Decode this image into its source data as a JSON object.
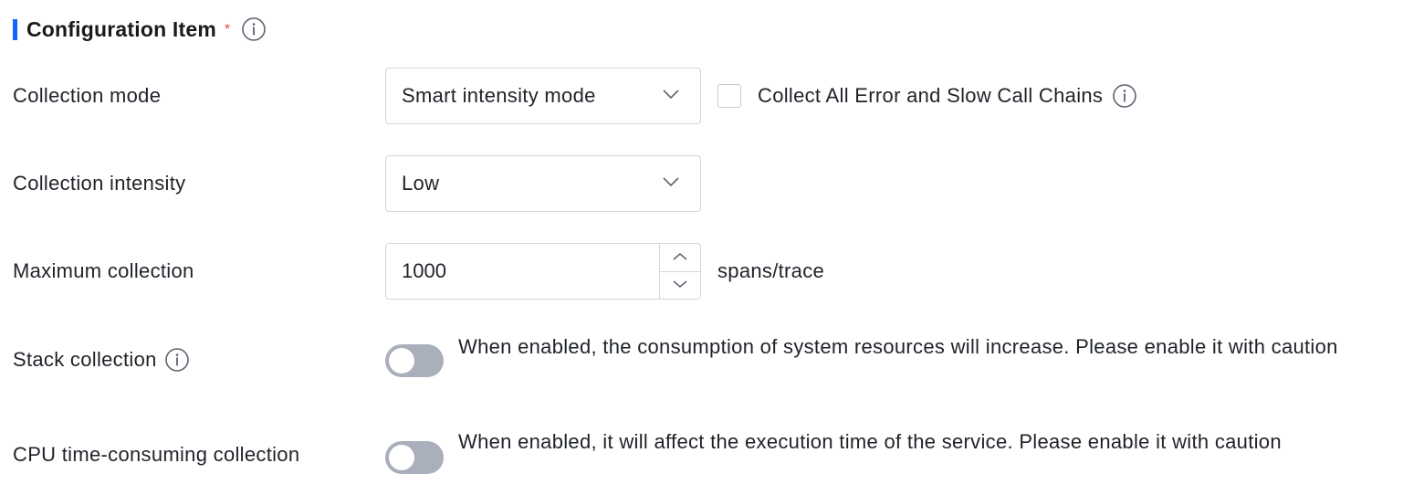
{
  "section": {
    "title": "Configuration Item",
    "required_mark": "*"
  },
  "rows": {
    "collection_mode": {
      "label": "Collection mode",
      "selected": "Smart intensity mode",
      "checkbox_label": "Collect All Error and Slow Call Chains",
      "checkbox_checked": false
    },
    "collection_intensity": {
      "label": "Collection intensity",
      "selected": "Low"
    },
    "maximum_collection": {
      "label": "Maximum collection",
      "value": "1000",
      "unit": "spans/trace"
    },
    "stack_collection": {
      "label": "Stack collection",
      "enabled": false,
      "hint": "When enabled, the consumption of system resources will increase. Please enable it with caution"
    },
    "cpu_collection": {
      "label": "CPU time-consuming collection",
      "enabled": false,
      "hint": "When enabled, it will affect the execution time of the service. Please enable it with caution"
    }
  },
  "colors": {
    "accent": "#1664ff",
    "required": "#e5484d",
    "border": "#d3d6db",
    "toggle_off": "#a9b0bb",
    "text": "#1f2329"
  },
  "icons": {
    "info": "info-circle-icon",
    "dropdown": "chevron-down-icon",
    "stepper_up": "chevron-up-icon",
    "stepper_down": "chevron-down-icon"
  }
}
